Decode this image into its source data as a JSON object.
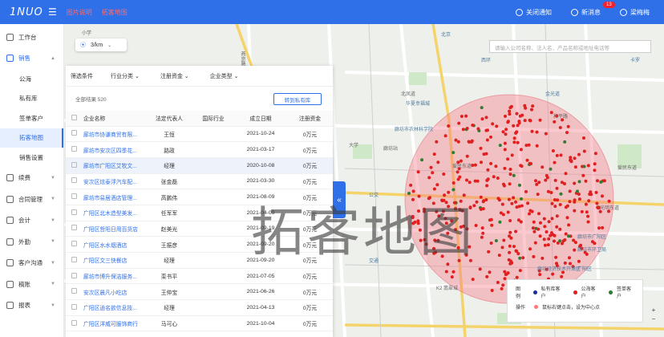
{
  "topbar": {
    "logo": "1NUO",
    "menu_icon": "menu-icon",
    "links": [
      "图片说明",
      "拓客地图"
    ],
    "close_notice": "关闭通知",
    "new_message": "新消息",
    "message_count": "13",
    "user_name": "梁梅梅",
    "link_color": "#ff6b6b",
    "brand_color": "#2f6fe8"
  },
  "sidebar": {
    "items": [
      {
        "label": "工作台",
        "icon": "workbench-icon"
      },
      {
        "label": "销售",
        "icon": "sales-icon",
        "expanded": true,
        "children": [
          "公海",
          "私有库",
          "签单客户",
          "拓客地图",
          "销售设置"
        ]
      },
      {
        "label": "续费",
        "icon": "renew-icon"
      },
      {
        "label": "合同管理",
        "icon": "contract-icon"
      },
      {
        "label": "会计",
        "icon": "accounting-icon"
      },
      {
        "label": "外勤",
        "icon": "field-icon"
      },
      {
        "label": "客户沟通",
        "icon": "communication-icon"
      },
      {
        "label": "稿账",
        "icon": "ledger-icon"
      },
      {
        "label": "报表",
        "icon": "report-icon"
      }
    ],
    "active_child": "拓客地图"
  },
  "map": {
    "radius": "3/km",
    "search_placeholder": "请输入公司名称、法人名、产品名称或地址电话等",
    "watermark": "拓客地图",
    "labels": [
      "小学",
      "燕京路",
      "廊坊站",
      "光明东道",
      "北凤道",
      "和平路",
      "爱民东道",
      "K2 翡翠城",
      "大学",
      "公交",
      "交通",
      "西环",
      "卡罗",
      "廊坊市农林科学院",
      "金光道",
      "廊坊市环卫局",
      "廊坊经济技术开发区",
      "爱民东道",
      "华夏幸福城",
      "廊坊市广阳区",
      "北京",
      "广阳区"
    ]
  },
  "panel": {
    "filter_title": "筛选条件",
    "filters": [
      "行业分类",
      "注册资金",
      "企业类型"
    ],
    "total_label": "全部结果 520",
    "transfer_button": "转到私有库",
    "columns": [
      "企业名称",
      "法定代表人",
      "国际行业",
      "成立日期",
      "注册资金"
    ],
    "rows": [
      {
        "name": "廊坊市协谦商贸有限...",
        "rep": "王恒",
        "industry": "",
        "date": "2021-10-24",
        "capital": "0万元"
      },
      {
        "name": "廊坊市安次区四季花...",
        "rep": "路政",
        "industry": "",
        "date": "2021-03-17",
        "capital": "0万元"
      },
      {
        "name": "廊坊市广阳区艾牧文...",
        "rep": "经理",
        "industry": "",
        "date": "2020-10-08",
        "capital": "0万元"
      },
      {
        "name": "安次区炫泰浮汽车配...",
        "rep": "张金磊",
        "industry": "",
        "date": "2021-03-30",
        "capital": "0万元"
      },
      {
        "name": "廊坊市易居酒店管理...",
        "rep": "高鹏伟",
        "industry": "",
        "date": "2021-08-09",
        "capital": "0万元"
      },
      {
        "name": "广阳区北木造型美发...",
        "rep": "任军军",
        "industry": "",
        "date": "2021-04-09",
        "capital": "0万元"
      },
      {
        "name": "广阳区哲阳日用百货店",
        "rep": "赵美光",
        "industry": "",
        "date": "2021-09-19",
        "capital": "0万元"
      },
      {
        "name": "广阳区水水烟酒店",
        "rep": "王振彦",
        "industry": "",
        "date": "2021-09-20",
        "capital": "0万元"
      },
      {
        "name": "广阳区文三快餐店",
        "rep": "经理",
        "industry": "",
        "date": "2021-09-20",
        "capital": "0万元"
      },
      {
        "name": "廊坊市博升保洁服务...",
        "rep": "栾书平",
        "industry": "",
        "date": "2021-07-05",
        "capital": "0万元"
      },
      {
        "name": "安次区晨凡小吃店",
        "rep": "王仲宝",
        "industry": "",
        "date": "2021-06-26",
        "capital": "0万元"
      },
      {
        "name": "广阳区逍名欲信息技...",
        "rep": "经理",
        "industry": "",
        "date": "2021-04-13",
        "capital": "0万元"
      },
      {
        "name": "广阳区洋威可服饰商行",
        "rep": "马可心",
        "industry": "",
        "date": "2021-10-04",
        "capital": "0万元"
      }
    ]
  },
  "legend": {
    "title": "图例",
    "items": [
      {
        "label": "私有库客户",
        "color": "#1a2fa0"
      },
      {
        "label": "公海客户",
        "color": "#e02020"
      },
      {
        "label": "签单客户",
        "color": "#2e7d32"
      }
    ],
    "op_title": "操作",
    "op_text": "鼠标右键点击，设为中心点",
    "op_color": "#ff7875"
  },
  "zoom": {
    "in": "+",
    "out": "−"
  }
}
